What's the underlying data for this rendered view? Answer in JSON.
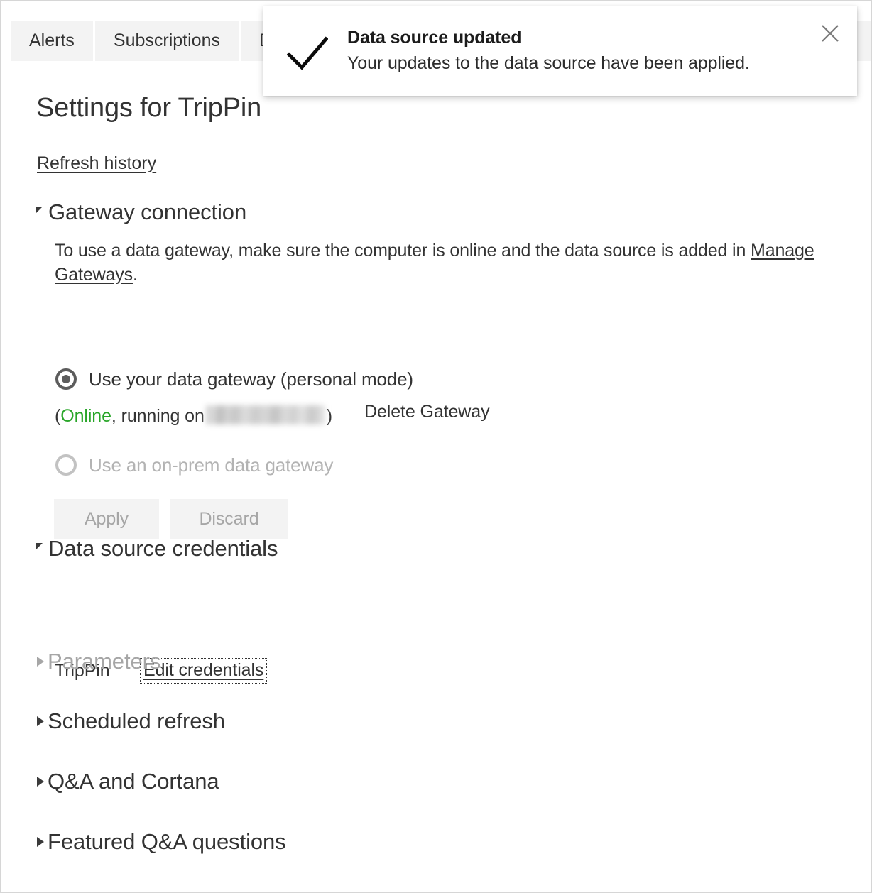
{
  "tabs": [
    {
      "label": "Alerts"
    },
    {
      "label": "Subscriptions"
    },
    {
      "label": "D"
    }
  ],
  "toast": {
    "icon": "checkmark-icon",
    "title": "Data source updated",
    "message": "Your updates to the data source have been applied.",
    "close_icon": "close-icon"
  },
  "page": {
    "title": "Settings for TripPin",
    "refresh_history_link": "Refresh history"
  },
  "gateway_section": {
    "header": "Gateway connection",
    "expanded": true,
    "description_before": "To use a data gateway, make sure the computer is online and the data source is added in ",
    "description_link": "Manage Gateways",
    "description_after": ".",
    "options": [
      {
        "label": "Use your data gateway (personal mode)",
        "selected": true,
        "enabled": true
      },
      {
        "label": "Use an on-prem data gateway",
        "selected": false,
        "enabled": false
      }
    ],
    "status": {
      "open_paren": "(",
      "state": "Online",
      "state_color": "#28a528",
      "running_on": ", running on ",
      "machine_name_redacted": true,
      "close_paren": ")"
    },
    "delete_gateway_link": "Delete Gateway",
    "apply_button": "Apply",
    "discard_button": "Discard",
    "buttons_enabled": false
  },
  "credentials_section": {
    "header": "Data source credentials",
    "expanded": true,
    "rows": [
      {
        "name": "TripPin",
        "action": "Edit credentials",
        "focused": true
      }
    ]
  },
  "collapsed_sections": [
    {
      "header": "Parameters",
      "enabled": false
    },
    {
      "header": "Scheduled refresh",
      "enabled": true
    },
    {
      "header": "Q&A and Cortana",
      "enabled": true
    },
    {
      "header": "Featured Q&A questions",
      "enabled": true
    }
  ]
}
